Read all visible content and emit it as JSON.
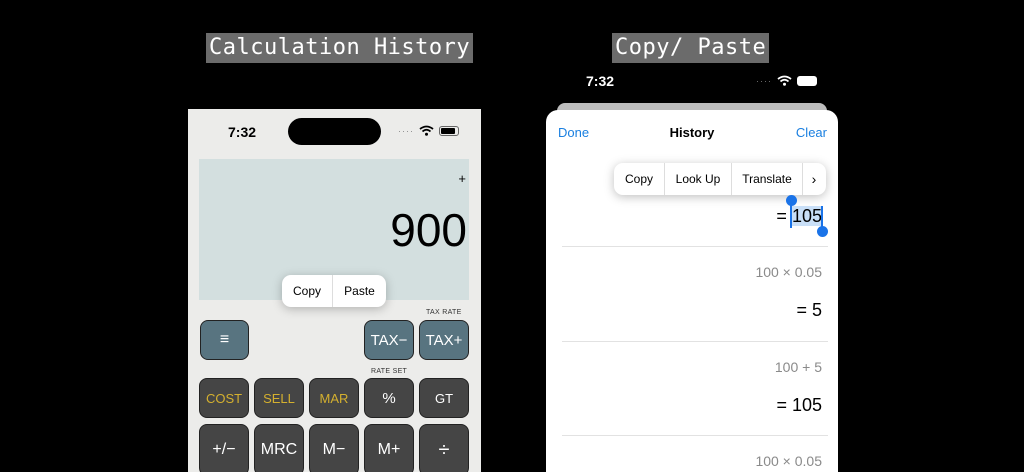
{
  "captions": {
    "left": "Calculation History",
    "right": "Copy/ Paste"
  },
  "left_phone": {
    "status_time": "7:32",
    "display": {
      "indicator": "+",
      "value": "900"
    },
    "popup": {
      "copy": "Copy",
      "paste": "Paste"
    },
    "labels": {
      "tax_rate": "TAX RATE",
      "rate_set": "RATE SET"
    },
    "keys": {
      "history": "≡",
      "tax_minus": "TAX−",
      "tax_plus": "TAX+",
      "cost": "COST",
      "sell": "SELL",
      "mar": "MAR",
      "percent": "%",
      "gt": "GT",
      "plus_minus": "+/−",
      "mrc": "MRC",
      "m_minus": "M−",
      "m_plus": "M+",
      "divide": "÷"
    }
  },
  "right_phone": {
    "status_time": "7:32",
    "nav": {
      "done": "Done",
      "title": "History",
      "clear": "Clear"
    },
    "context_menu": {
      "copy": "Copy",
      "look_up": "Look Up",
      "translate": "Translate",
      "more": "›"
    },
    "history": {
      "first_result_prefix": "=",
      "first_result_selected": "105",
      "entries": [
        {
          "expr": "100 × 0.05",
          "result": "= 5"
        },
        {
          "expr": "100 + 5",
          "result": "= 105"
        },
        {
          "expr": "100 × 0.05"
        }
      ]
    }
  },
  "colors": {
    "accent": "#1a7fe0",
    "key_blue": "#587480",
    "key_dark": "#454545",
    "key_yellow_text": "#d4b02f",
    "display_bg": "#d3dfdf"
  }
}
